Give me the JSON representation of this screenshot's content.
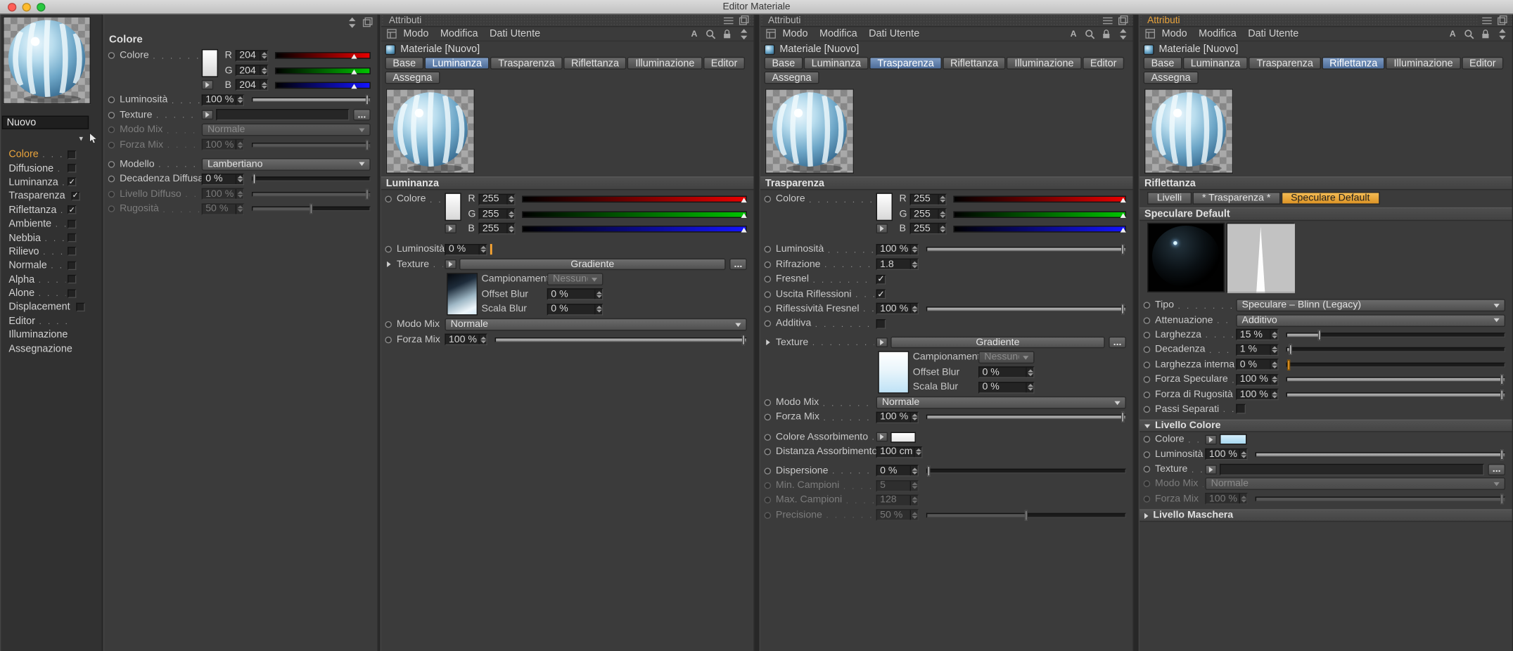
{
  "titlebar": {
    "title": "Editor Materiale"
  },
  "colors": {
    "accent_orange": "#e8a33c",
    "tab_selected_blue": "#4d6c99"
  },
  "preview_panel": {
    "material_name": "Nuovo",
    "channels": [
      {
        "label": "Colore",
        "checkbox": "unchecked",
        "active": true
      },
      {
        "label": "Diffusione",
        "checkbox": "unchecked"
      },
      {
        "label": "Luminanza",
        "checkbox": "checked"
      },
      {
        "label": "Trasparenza",
        "checkbox": "checked"
      },
      {
        "label": "Riflettanza",
        "checkbox": "checked"
      },
      {
        "label": "Ambiente",
        "checkbox": "unchecked"
      },
      {
        "label": "Nebbia",
        "checkbox": "unchecked"
      },
      {
        "label": "Rilievo",
        "checkbox": "unchecked"
      },
      {
        "label": "Normale",
        "checkbox": "unchecked"
      },
      {
        "label": "Alpha",
        "checkbox": "unchecked"
      },
      {
        "label": "Alone",
        "checkbox": "unchecked"
      },
      {
        "label": "Displacement",
        "checkbox": "unchecked"
      },
      {
        "label": "Editor",
        "checkbox": "none",
        "leader": true
      },
      {
        "label": "Illuminazione",
        "checkbox": "none",
        "leader": false
      },
      {
        "label": "Assegnazione",
        "checkbox": "none",
        "leader": false
      }
    ]
  },
  "color_panel": {
    "title": "Colore",
    "colore_label": "Colore",
    "r_label": "R",
    "g_label": "G",
    "b_label": "B",
    "r_value": "204",
    "g_value": "204",
    "b_value": "204",
    "luminosita_label": "Luminosità",
    "luminosita_value": "100 %",
    "texture_label": "Texture",
    "more_button": "...",
    "modo_mix_label": "Modo Mix",
    "modo_mix_value": "Normale",
    "forza_mix_label": "Forza Mix",
    "forza_mix_value": "100 %",
    "modello_label": "Modello",
    "modello_value": "Lambertiano",
    "decadenza_diffusa_label": "Decadenza Diffusa",
    "decadenza_diffusa_value": "0 %",
    "livello_diffuso_label": "Livello Diffuso",
    "livello_diffuso_value": "100 %",
    "rugosita_label": "Rugosità",
    "rugosita_value": "50 %"
  },
  "attributi_common": {
    "panel_title": "Attributi",
    "menu": [
      "Modo",
      "Modifica",
      "Dati Utente"
    ],
    "material_label": "Materiale [Nuovo]",
    "tabs": [
      "Base",
      "Luminanza",
      "Trasparenza",
      "Riflettanza",
      "Illuminazione",
      "Editor"
    ],
    "tab_assegna": "Assegna"
  },
  "luminanza_panel": {
    "selected_tab": "Luminanza",
    "section_title": "Luminanza",
    "colore_label": "Colore",
    "r_label": "R",
    "g_label": "G",
    "b_label": "B",
    "r_value": "255",
    "g_value": "255",
    "b_value": "255",
    "luminosita_label": "Luminosità",
    "luminosita_value": "0 %",
    "texture_label": "Texture",
    "texture_button": "Gradiente",
    "more_button": "...",
    "campionamento_label": "Campionamento",
    "campionamento_value": "Nessuno",
    "offset_blur_label": "Offset Blur",
    "offset_blur_value": "0 %",
    "scala_blur_label": "Scala Blur",
    "scala_blur_value": "0 %",
    "modo_mix_label": "Modo Mix",
    "modo_mix_value": "Normale",
    "forza_mix_label": "Forza Mix",
    "forza_mix_value": "100 %"
  },
  "trasparenza_panel": {
    "selected_tab": "Trasparenza",
    "section_title": "Trasparenza",
    "colore_label": "Colore",
    "r_label": "R",
    "g_label": "G",
    "b_label": "B",
    "r_value": "255",
    "g_value": "255",
    "b_value": "255",
    "luminosita_label": "Luminosità",
    "luminosita_value": "100 %",
    "rifrazione_label": "Rifrazione",
    "rifrazione_value": "1.8",
    "fresnel_label": "Fresnel",
    "uscita_riflessioni_label": "Uscita Riflessioni",
    "riflessivita_fresnel_label": "Riflessività Fresnel",
    "riflessivita_fresnel_value": "100 %",
    "additiva_label": "Additiva",
    "texture_label": "Texture",
    "texture_button": "Gradiente",
    "more_button": "...",
    "campionamento_label": "Campionamento",
    "campionamento_value": "Nessuno",
    "offset_blur_label": "Offset Blur",
    "offset_blur_value": "0 %",
    "scala_blur_label": "Scala Blur",
    "scala_blur_value": "0 %",
    "modo_mix_label": "Modo Mix",
    "modo_mix_value": "Normale",
    "forza_mix_label": "Forza Mix",
    "forza_mix_value": "100 %",
    "colore_assorbimento_label": "Colore Assorbimento",
    "distanza_assorbimento_label": "Distanza Assorbimento",
    "distanza_assorbimento_value": "100 cm",
    "dispersione_label": "Dispersione",
    "dispersione_value": "0 %",
    "min_campioni_label": "Min. Campioni",
    "min_campioni_value": "5",
    "max_campioni_label": "Max. Campioni",
    "max_campioni_value": "128",
    "precisione_label": "Precisione",
    "precisione_value": "50 %"
  },
  "riflettanza_panel": {
    "selected_tab": "Riflettanza",
    "section_title": "Riflettanza",
    "layer_tabs": [
      "Livelli",
      "* Trasparenza *",
      "Speculare Default"
    ],
    "active_layer": "Speculare Default",
    "subsection_title": "Speculare Default",
    "tipo_label": "Tipo",
    "tipo_value": "Speculare – Blinn (Legacy)",
    "attenuazione_label": "Attenuazione",
    "attenuazione_value": "Additivo",
    "larghezza_label": "Larghezza",
    "larghezza_value": "15 %",
    "decadenza_label": "Decadenza",
    "decadenza_value": "1 %",
    "larghezza_interna_label": "Larghezza interna",
    "larghezza_interna_value": "0 %",
    "forza_speculare_label": "Forza Speculare",
    "forza_speculare_value": "100 %",
    "forza_rugosita_label": "Forza di Rugosità",
    "forza_rugosita_value": "100 %",
    "passi_separati_label": "Passi Separati",
    "livello_colore_title": "Livello Colore",
    "colore_label": "Colore",
    "luminosita_label": "Luminosità",
    "luminosita_value": "100 %",
    "texture_label": "Texture",
    "more_button": "...",
    "modo_mix_label": "Modo Mix",
    "modo_mix_value": "Normale",
    "forza_mix_label": "Forza Mix",
    "forza_mix_value": "100 %",
    "livello_maschera_title": "Livello Maschera"
  }
}
